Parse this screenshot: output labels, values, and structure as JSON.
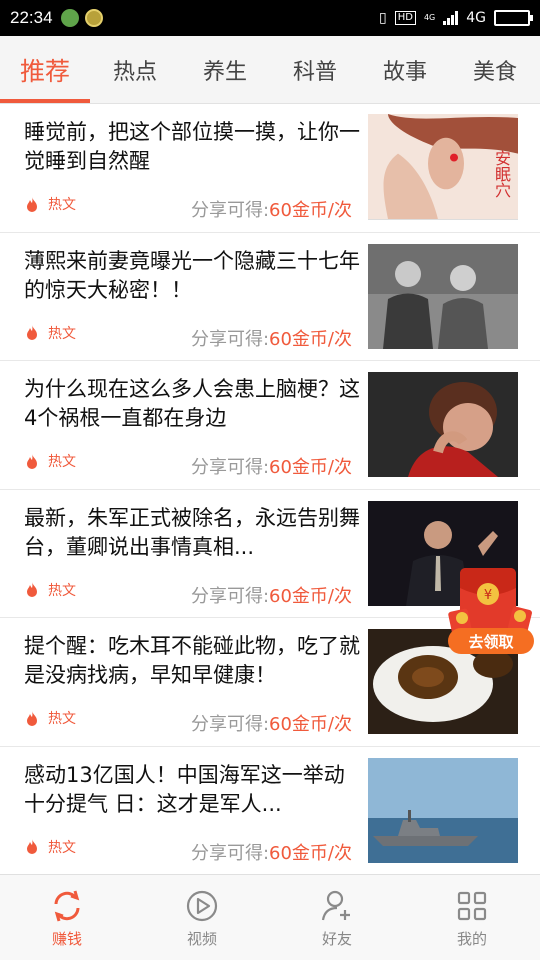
{
  "status_bar": {
    "time": "22:34",
    "hd": "HD",
    "network": "4G",
    "small_network": "4G",
    "battery_level": 0.85
  },
  "tabs": [
    {
      "label": "推荐",
      "active": true
    },
    {
      "label": "热点"
    },
    {
      "label": "养生"
    },
    {
      "label": "科普"
    },
    {
      "label": "故事"
    },
    {
      "label": "美食"
    }
  ],
  "articles": [
    {
      "title": "睡觉前，把这个部位摸一摸，让你一觉睡到自然醒",
      "tag": "热文",
      "reward_prefix": "分享可得:",
      "reward_amount": "60金币/次",
      "thumb_icon": "ear-acupoint-image",
      "thumb_text": "安眠穴"
    },
    {
      "title": "薄熙来前妻竟曝光一个隐藏三十七年的惊天大秘密！！",
      "tag": "热文",
      "reward_prefix": "分享可得:",
      "reward_amount": "60金币/次",
      "thumb_icon": "couple-photo-image"
    },
    {
      "title": "为什么现在这么多人会患上脑梗？这4个祸根一直都在身边",
      "tag": "热文",
      "reward_prefix": "分享可得:",
      "reward_amount": "60金币/次",
      "thumb_icon": "woman-headache-image"
    },
    {
      "title": "最新，朱军正式被除名，永远告别舞台，董卿说出事情真相...",
      "tag": "热文",
      "reward_prefix": "分享可得:",
      "reward_amount": "60金币/次",
      "thumb_icon": "host-on-stage-image"
    },
    {
      "title": "提个醒：吃木耳不能碰此物，吃了就是没病找病，早知早健康！",
      "tag": "热文",
      "reward_prefix": "分享可得:",
      "reward_amount": "60金币/次",
      "thumb_icon": "wood-ear-dish-image"
    },
    {
      "title": "感动13亿国人！中国海军这一举动十分提气 日：这才是军人...",
      "tag": "热文",
      "reward_prefix": "分享可得:",
      "reward_amount": "60金币/次",
      "thumb_icon": "navy-ship-image"
    }
  ],
  "red_packet": {
    "label": "去领取"
  },
  "bottom_nav": [
    {
      "label": "赚钱",
      "icon": "refresh-icon",
      "active": true
    },
    {
      "label": "视频",
      "icon": "play-icon"
    },
    {
      "label": "好友",
      "icon": "add-friend-icon"
    },
    {
      "label": "我的",
      "icon": "grid-icon"
    }
  ],
  "colors": {
    "accent": "#f05a3c",
    "muted": "#999999",
    "tab_bg": "#f5f5f5"
  }
}
